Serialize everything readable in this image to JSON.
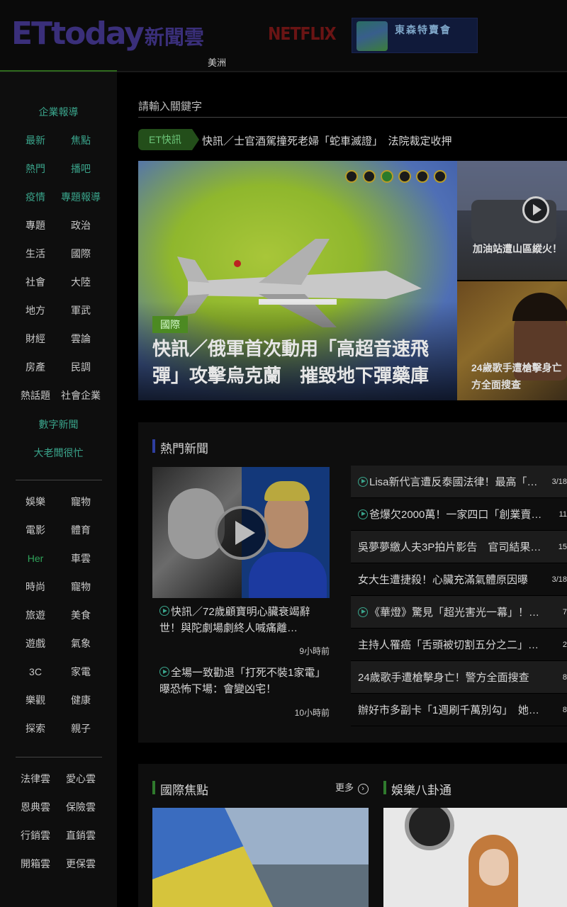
{
  "header": {
    "logo_brand": "ETtoday",
    "logo_cloud": "新聞雲",
    "region": "美洲",
    "netflix": "NETFLIX",
    "banner_text": "東森特賣會"
  },
  "sidebar": {
    "top_title": "企業報導",
    "group1": [
      [
        "最新",
        "焦點"
      ],
      [
        "熱門",
        "播吧"
      ],
      [
        "疫情",
        "專題報導"
      ],
      [
        "專題",
        "政治"
      ],
      [
        "生活",
        "國際"
      ],
      [
        "社會",
        "大陸"
      ],
      [
        "地方",
        "軍武"
      ],
      [
        "財經",
        "雲論"
      ],
      [
        "房產",
        "民調"
      ],
      [
        "熱話題",
        "社會企業"
      ]
    ],
    "digital": "數字新聞",
    "boss": "大老闆很忙",
    "group2": [
      [
        "娛樂",
        "寵物"
      ],
      [
        "電影",
        "體育"
      ],
      [
        "Her",
        "車雲"
      ],
      [
        "時尚",
        "寵物"
      ],
      [
        "旅遊",
        "美食"
      ],
      [
        "遊戲",
        "氣象"
      ],
      [
        "3C",
        "家電"
      ],
      [
        "樂觀",
        "健康"
      ],
      [
        "探索",
        "親子"
      ]
    ],
    "group3": [
      [
        "法律雲",
        "愛心雲"
      ],
      [
        "恩典雲",
        "保險雲"
      ],
      [
        "行銷雲",
        "直銷雲"
      ],
      [
        "開箱雲",
        "更保雲"
      ]
    ]
  },
  "search": {
    "placeholder": "請輸入關鍵字"
  },
  "flash": {
    "badge": "ET快訊",
    "text": "快訊／士官酒駕撞死老婦「蛇車滅證」　法院裁定收押"
  },
  "hero": {
    "tag": "國際",
    "headline": "快訊／俄軍首次動用「高超音速飛彈」攻擊烏克蘭　摧毀地下彈藥庫",
    "slide_count": 6,
    "active_slide": 3
  },
  "side_news": [
    {
      "caption": "加油站遭山區縱火！"
    },
    {
      "caption": "24歲歌手遭槍擊身亡方全面搜查"
    }
  ],
  "hot": {
    "title": "熱門新聞",
    "featured": [
      {
        "caption": "快訊／72歲顧寶明心臟衰竭辭世！與陀劇場劇終人喊痛離…",
        "time": "9小時前"
      },
      {
        "caption": "全場一致勸退「打死不裝1家電」　曝恐怖下場：會變凶宅！",
        "time": "10小時前"
      }
    ],
    "list": [
      {
        "text": "Lisa新代言遭反泰國法律！最高「…",
        "date": "3/18",
        "video": true,
        "dark": true
      },
      {
        "text": "爸爆欠2000萬！一家四口「創業賣…",
        "date": "11",
        "video": true,
        "dark": false
      },
      {
        "text": "吳夢夢繳人夫3P拍片影告　官司結果…",
        "date": "15",
        "video": false,
        "dark": true
      },
      {
        "text": "女大生遭捷殺！心臟充滿氣體原因曝",
        "date": "3/18",
        "video": false,
        "dark": false
      },
      {
        "text": "《華燈》驚見「超光害光一幕」！…",
        "date": "7",
        "video": true,
        "dark": true
      },
      {
        "text": "主持人罹癌「舌頭被切割五分之二」…",
        "date": "2",
        "video": false,
        "dark": false
      },
      {
        "text": "24歲歌手遭槍擊身亡！警方全面搜查",
        "date": "8",
        "video": false,
        "dark": true
      },
      {
        "text": "辦好市多副卡「1週刷千萬別勾」　她…",
        "date": "8",
        "video": false,
        "dark": false
      }
    ]
  },
  "bottom": {
    "intl_title": "國際焦點",
    "more": "更多",
    "ent_title": "娛樂八卦通"
  }
}
